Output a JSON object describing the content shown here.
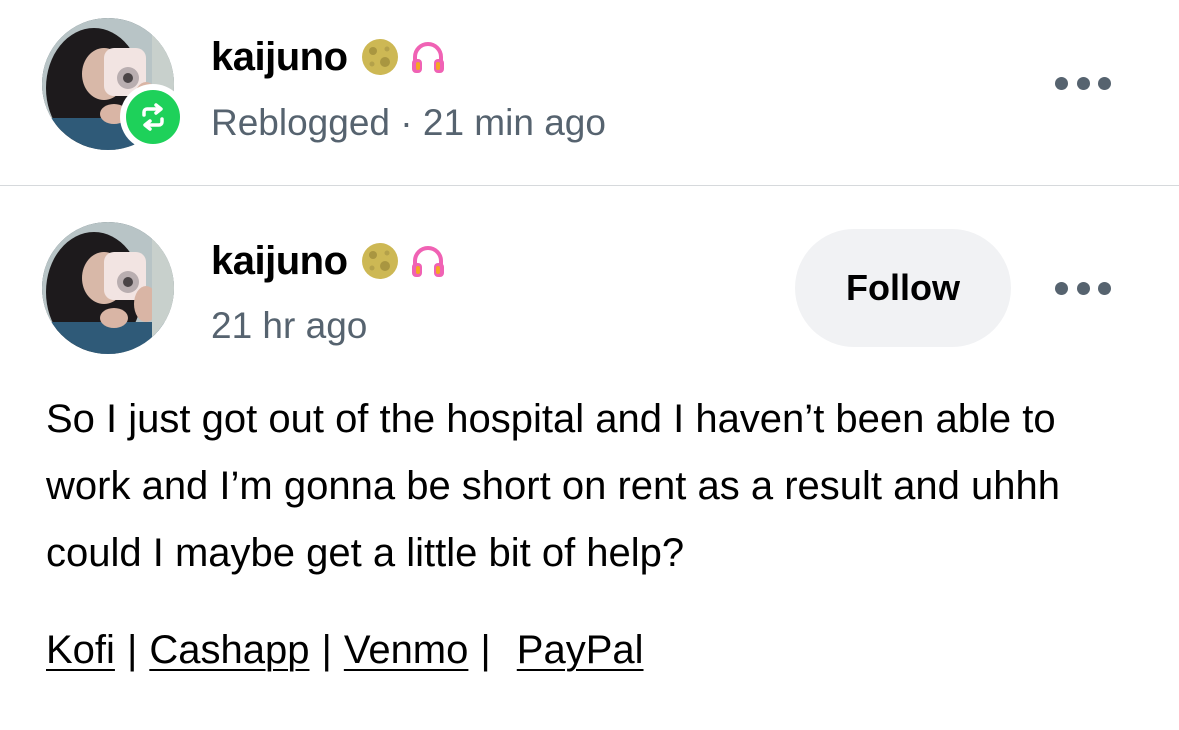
{
  "reblog": {
    "blog_name": "kaijuno",
    "status_text": "Reblogged",
    "separator": "·",
    "time_ago": "21 min ago"
  },
  "post": {
    "blog_name": "kaijuno",
    "time_ago": "21 hr ago",
    "follow_label": "Follow",
    "body": "So I just got out of the hospital and I haven’t been able to work and I’m gonna be short on rent as a result and uhhh could I maybe get a little bit of help?",
    "links": [
      {
        "label": "Kofi"
      },
      {
        "label": "Cashapp"
      },
      {
        "label": "Venmo"
      },
      {
        "label": "PayPal"
      }
    ],
    "link_separator": "|"
  },
  "icons": {
    "moon": "moon-icon",
    "headphones": "headphones-icon",
    "reblog": "reblog-icon",
    "more": "more-options-icon"
  },
  "colors": {
    "reblog_green": "#1ed15a",
    "meta_gray": "#56636f",
    "headphones_pink": "#f062b4",
    "follow_bg": "#f1f2f4"
  }
}
